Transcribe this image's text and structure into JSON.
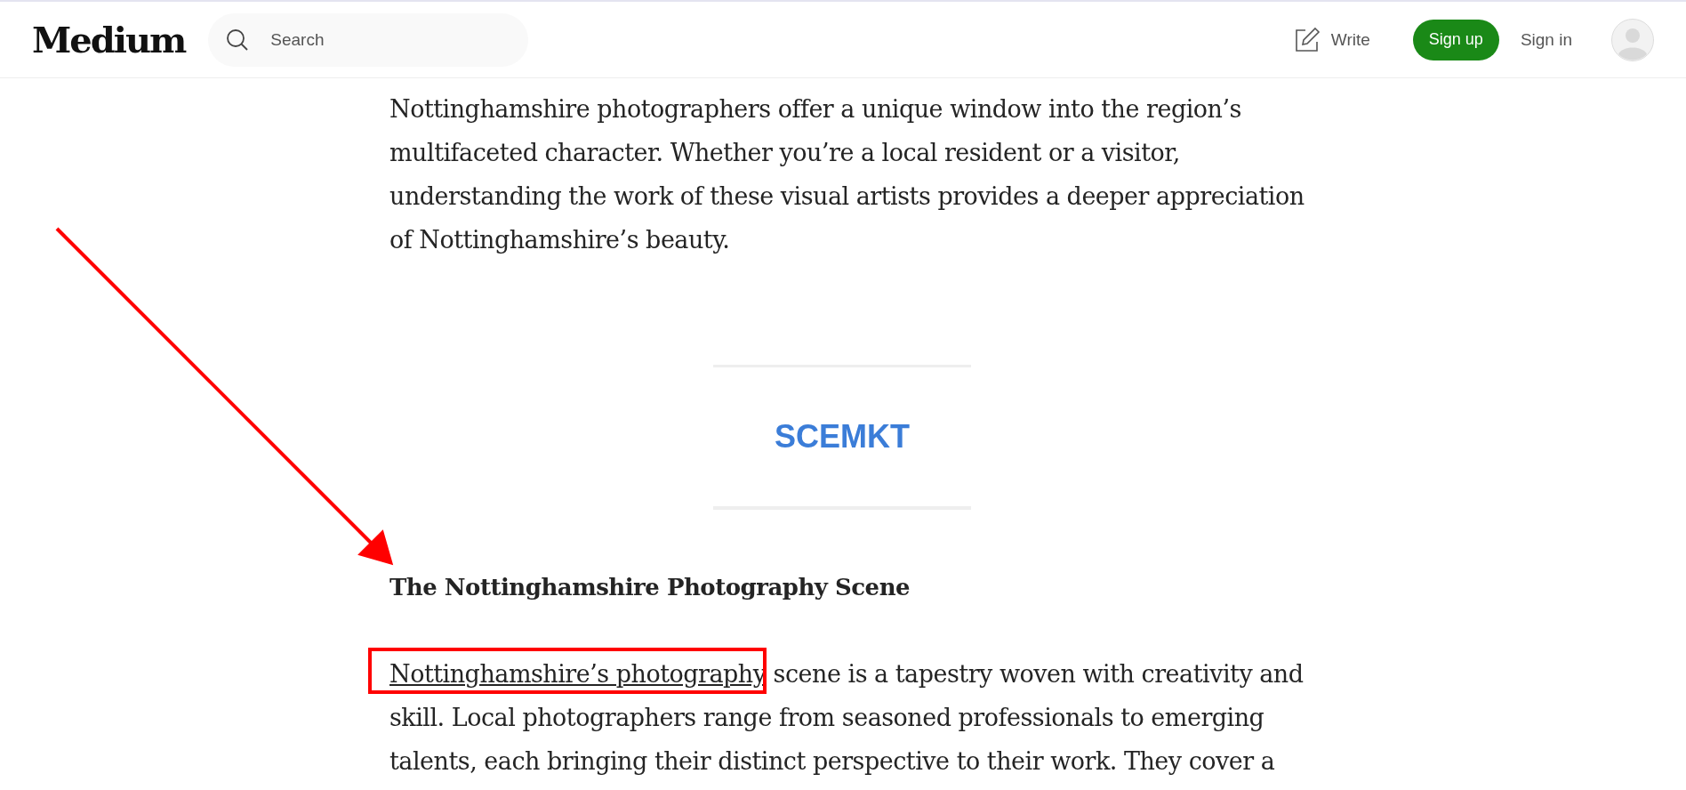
{
  "header": {
    "logo": "Medium",
    "search": {
      "placeholder": "Search"
    },
    "write": "Write",
    "sign_up": "Sign up",
    "sign_in": "Sign in"
  },
  "article": {
    "intro": "Nottinghamshire photographers offer a unique window into the region’s multifaceted character. Whether you’re a local resident or a visitor, understanding the work of these visual artists provides a deeper appreciation of Nottinghamshire’s beauty.",
    "image_text": "SCEMKT",
    "heading": "The Nottinghamshire Photography Scene",
    "paragraph": {
      "link": "Nottinghamshire’s photography",
      "text": " scene is a tapestry woven with creativity and skill. Local photographers range from seasoned professionals to emerging talents, each bringing their distinct perspective to their work. They cover a"
    }
  },
  "annotations": {
    "arrow": true,
    "highlight_box": true
  }
}
